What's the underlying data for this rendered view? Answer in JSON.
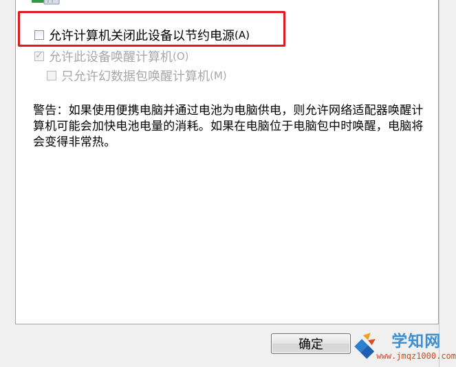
{
  "options": {
    "allow_power_off": {
      "label": "允许计算机关闭此设备以节约电源",
      "hotkey": "(A)",
      "checked": false
    },
    "allow_wake": {
      "label": "允许此设备唤醒计算机",
      "hotkey": "(O)",
      "checked": true,
      "disabled": true
    },
    "magic_packet_only": {
      "label": "只允许幻数据包唤醒计算机",
      "hotkey": "(M)",
      "checked": false,
      "disabled": true
    }
  },
  "warning_text": "警告：如果使用便携电脑并通过电池为电脑供电，则允许网络适配器唤醒计算机可能会加快电池电量的消耗。如果在电脑位于电脑包中时唤醒，电脑将会变得非常热。",
  "buttons": {
    "ok": "确定"
  },
  "watermark": {
    "title": "学知网",
    "url": "www.jmqz1000.com"
  },
  "colors": {
    "highlight": "#e0191f",
    "disabled_text": "#a8a8a8"
  }
}
